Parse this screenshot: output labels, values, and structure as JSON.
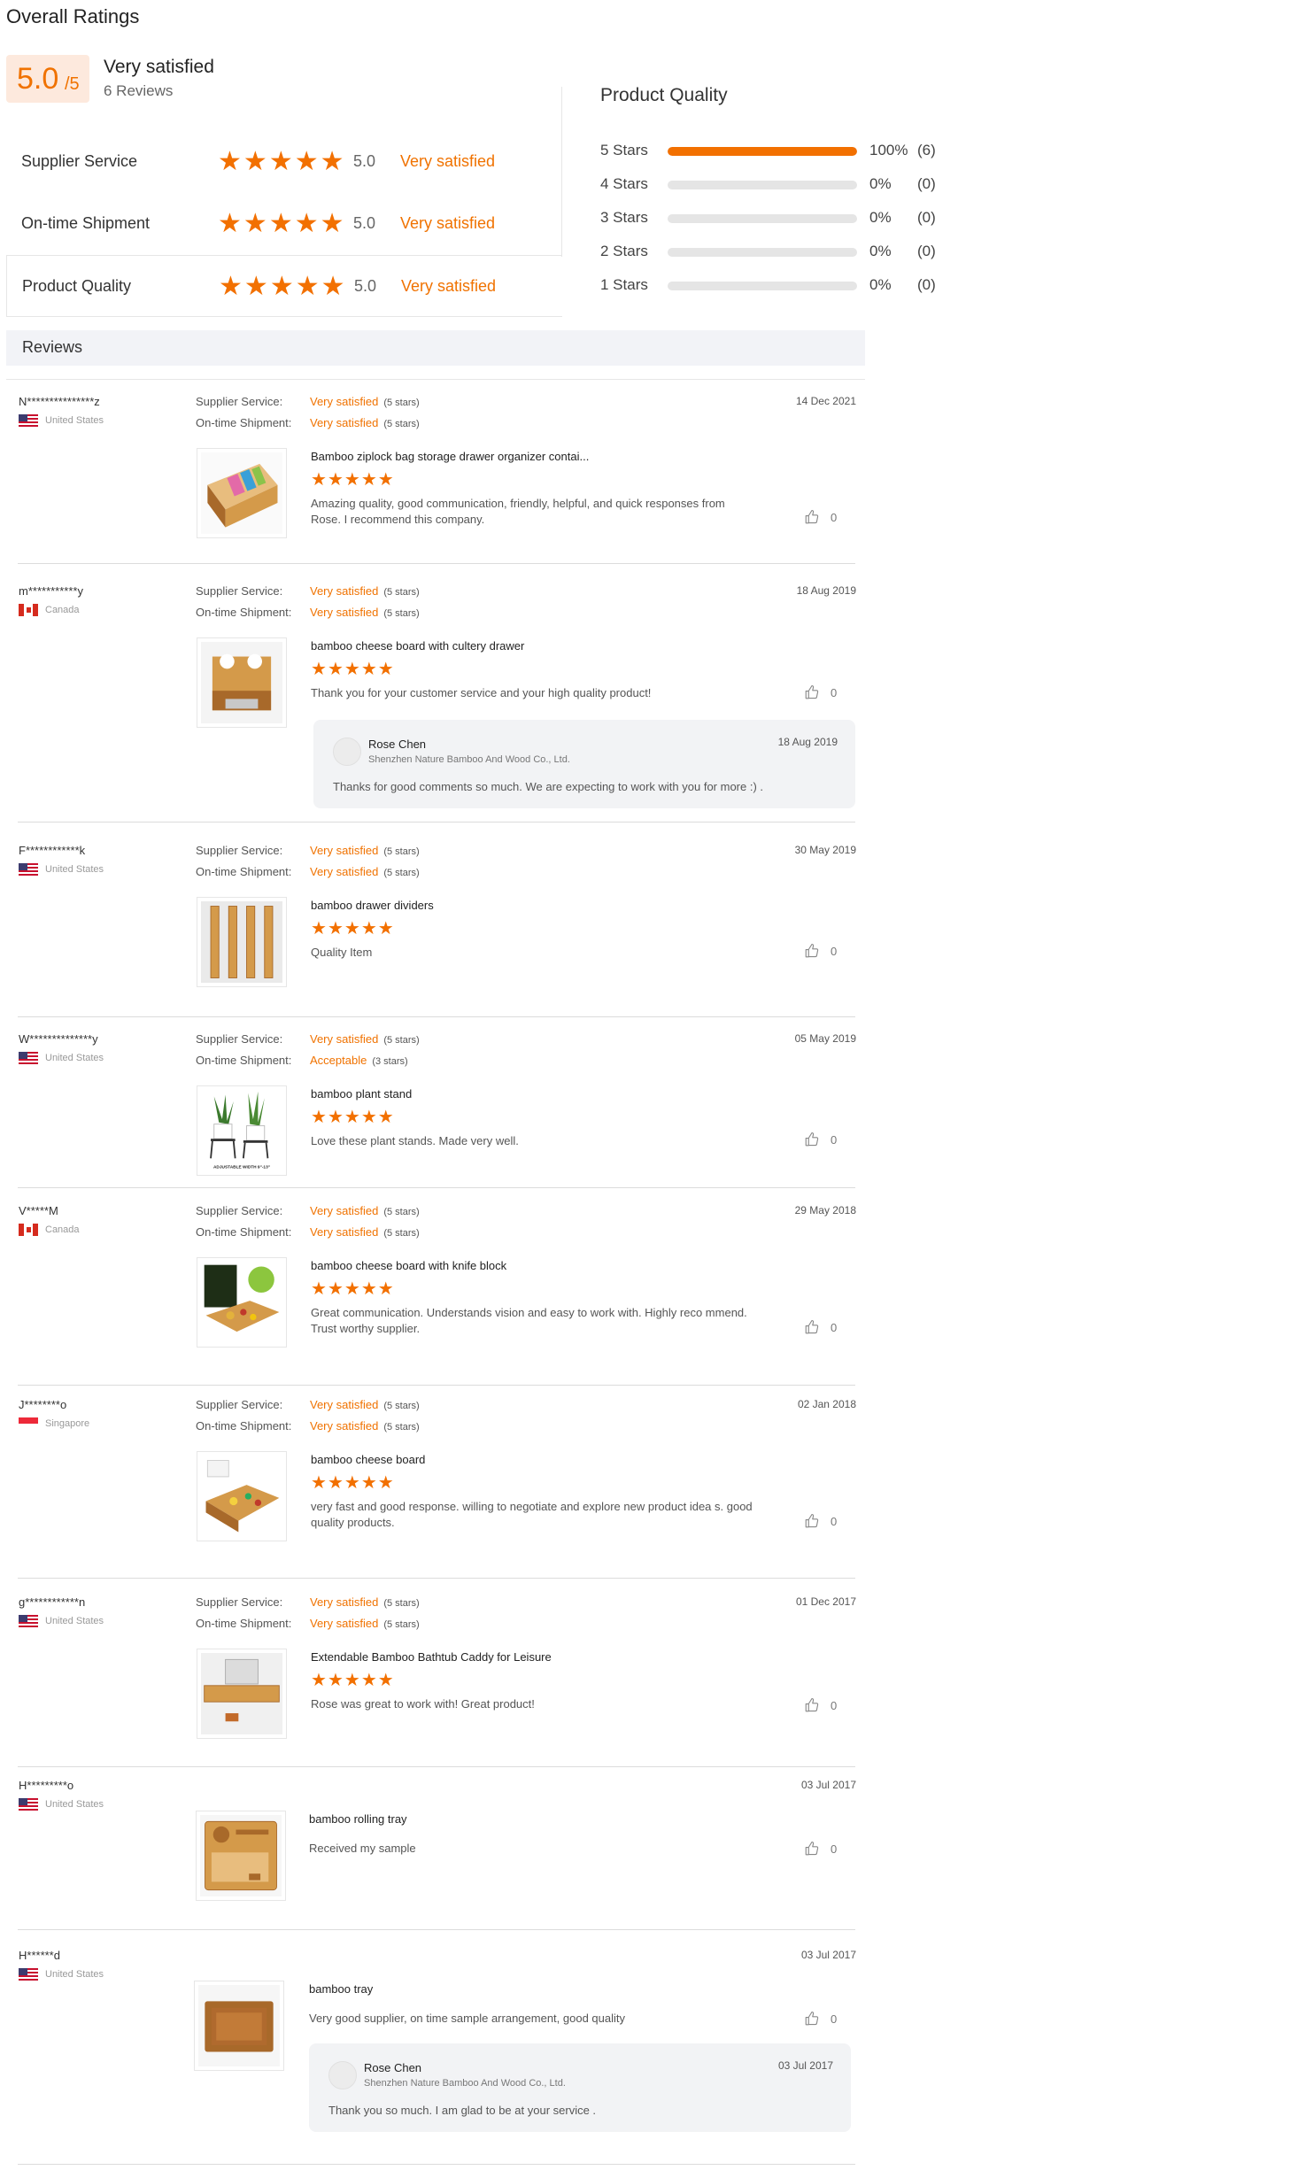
{
  "overall": {
    "title": "Overall Ratings",
    "score": "5.0",
    "score_suffix": "/5",
    "label": "Very satisfied",
    "count": "6 Reviews"
  },
  "sub_ratings": [
    {
      "label": "Supplier Service",
      "value": "5.0",
      "text": "Very satisfied",
      "stars": 5
    },
    {
      "label": "On-time Shipment",
      "value": "5.0",
      "text": "Very satisfied",
      "stars": 5
    },
    {
      "label": "Product Quality",
      "value": "5.0",
      "text": "Very satisfied",
      "stars": 5
    }
  ],
  "product_quality": {
    "title": "Product Quality",
    "rows": [
      {
        "label": "5  Stars",
        "pct": "100%",
        "count": "(6)",
        "fraction": 1.0
      },
      {
        "label": "4  Stars",
        "pct": "0%",
        "count": "(0)",
        "fraction": 0
      },
      {
        "label": "3  Stars",
        "pct": "0%",
        "count": "(0)",
        "fraction": 0
      },
      {
        "label": "2  Stars",
        "pct": "0%",
        "count": "(0)",
        "fraction": 0
      },
      {
        "label": "1  Stars",
        "pct": "0%",
        "count": "(0)",
        "fraction": 0
      }
    ]
  },
  "reviews_header": "Reviews",
  "labels": {
    "supplier_service": "Supplier Service:",
    "ontime_shipment": "On-time Shipment:"
  },
  "colors": {
    "accent": "#f27000",
    "score_bg": "#fde9dd",
    "header_bg": "#f2f3f7"
  },
  "reviews": [
    {
      "user": "N***************z",
      "country": "United States",
      "flag": "us",
      "supplier": "Very satisfied",
      "supplier_stars": "(5 stars)",
      "shipment": "Very satisfied",
      "shipment_stars": "(5 stars)",
      "date": "14 Dec 2021",
      "product": "Bamboo ziplock bag storage drawer organizer contai...",
      "comment": "Amazing quality, good communication, friendly, helpful, and quick responses from Rose. I recommend this company.",
      "likes": "0",
      "thumb": "ziplock"
    },
    {
      "user": "m***********y",
      "country": "Canada",
      "flag": "ca",
      "supplier": "Very satisfied",
      "supplier_stars": "(5 stars)",
      "shipment": "Very satisfied",
      "shipment_stars": "(5 stars)",
      "date": "18 Aug 2019",
      "product": "bamboo cheese board with cultery drawer",
      "comment": "Thank you for your customer service and your high quality product!",
      "likes": "0",
      "thumb": "cheese1",
      "reply": {
        "name": "Rose Chen",
        "company": "Shenzhen Nature Bamboo And Wood Co., Ltd.",
        "date": "18 Aug 2019",
        "text": "Thanks for good comments so much. We are expecting to work with you for more :) ."
      }
    },
    {
      "user": "F************k",
      "country": "United States",
      "flag": "us",
      "supplier": "Very satisfied",
      "supplier_stars": "(5 stars)",
      "shipment": "Very satisfied",
      "shipment_stars": "(5 stars)",
      "date": "30 May 2019",
      "product": "bamboo drawer dividers",
      "comment": "Quality Item",
      "likes": "0",
      "thumb": "dividers"
    },
    {
      "user": "W**************y",
      "country": "United States",
      "flag": "us",
      "supplier": "Very satisfied",
      "supplier_stars": "(5 stars)",
      "shipment": "Acceptable",
      "shipment_stars": "(3 stars)",
      "date": "05 May 2019",
      "product": "bamboo plant stand",
      "comment": "Love these plant stands. Made very well.",
      "likes": "0",
      "thumb": "plant",
      "thumb_caption": "ADJUSTABLE WIDTH 9\"-13\""
    },
    {
      "user": "V*****M",
      "country": "Canada",
      "flag": "ca",
      "supplier": "Very satisfied",
      "supplier_stars": "(5 stars)",
      "shipment": "Very satisfied",
      "shipment_stars": "(5 stars)",
      "date": "29 May 2018",
      "product": "bamboo cheese board with knife block",
      "comment": "Great communication. Understands vision and easy to work with. Highly reco mmend. Trust worthy supplier.",
      "likes": "0",
      "thumb": "cheese2"
    },
    {
      "user": "J********o",
      "country": "Singapore",
      "flag": "sg",
      "supplier": "Very satisfied",
      "supplier_stars": "(5 stars)",
      "shipment": "Very satisfied",
      "shipment_stars": "(5 stars)",
      "date": "02 Jan 2018",
      "product": "bamboo cheese board",
      "comment": "very fast and good response. willing to negotiate and explore new product idea s. good quality products.",
      "likes": "0",
      "thumb": "cheese3"
    },
    {
      "user": "g************n",
      "country": "United States",
      "flag": "us",
      "supplier": "Very satisfied",
      "supplier_stars": "(5 stars)",
      "shipment": "Very satisfied",
      "shipment_stars": "(5 stars)",
      "date": "01 Dec 2017",
      "product": "Extendable Bamboo Bathtub Caddy for Leisure",
      "comment": "Rose was great to work with! Great product!",
      "likes": "0",
      "thumb": "caddy"
    },
    {
      "user": "H*********o",
      "country": "United States",
      "flag": "us",
      "date": "03 Jul 2017",
      "product": "bamboo rolling tray",
      "comment": "Received my sample",
      "likes": "0",
      "thumb": "rolling"
    },
    {
      "user": "H******d",
      "country": "United States",
      "flag": "us",
      "date": "03 Jul 2017",
      "product": "bamboo tray",
      "comment": "Very good supplier, on time sample arrangement, good quality",
      "likes": "0",
      "thumb": "tray",
      "reply": {
        "name": "Rose Chen",
        "company": "Shenzhen Nature Bamboo And Wood Co., Ltd.",
        "date": "03 Jul 2017",
        "text": "Thank you so much. I am glad to be at your service ."
      }
    }
  ]
}
